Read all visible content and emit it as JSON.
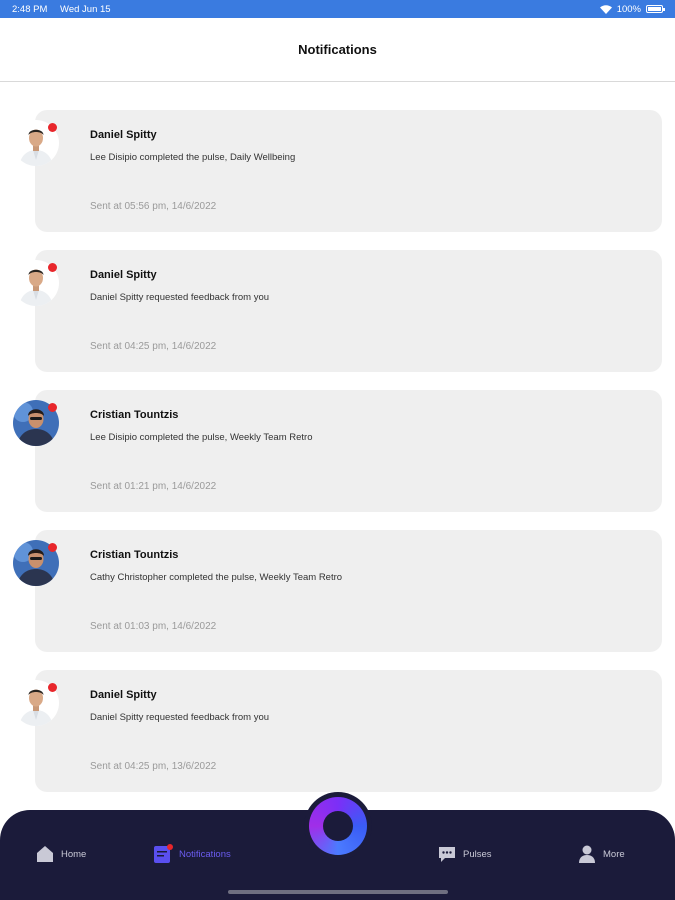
{
  "status_bar": {
    "time": "2:48 PM",
    "date": "Wed Jun 15",
    "battery": "100%"
  },
  "header": {
    "title": "Notifications"
  },
  "notifications": [
    {
      "sender": "Daniel Spitty",
      "message": "Lee Disipio completed the pulse, Daily Wellbeing",
      "time": "Sent at 05:56 pm, 14/6/2022",
      "avatar": "man-white-shirt",
      "unread": true
    },
    {
      "sender": "Daniel Spitty",
      "message": "Daniel Spitty requested feedback from you",
      "time": "Sent at 04:25 pm, 14/6/2022",
      "avatar": "man-white-shirt",
      "unread": true
    },
    {
      "sender": "Cristian Tountzis",
      "message": "Lee Disipio completed the pulse, Weekly Team Retro",
      "time": "Sent at 01:21 pm, 14/6/2022",
      "avatar": "man-blue-photo",
      "unread": true
    },
    {
      "sender": "Cristian Tountzis",
      "message": "Cathy Christopher completed the pulse, Weekly Team Retro",
      "time": "Sent at 01:03 pm, 14/6/2022",
      "avatar": "man-blue-photo",
      "unread": true
    },
    {
      "sender": "Daniel Spitty",
      "message": "Daniel Spitty requested feedback from you",
      "time": "Sent at 04:25 pm, 13/6/2022",
      "avatar": "man-white-shirt",
      "unread": true
    }
  ],
  "bottom_nav": {
    "home": "Home",
    "notifications": "Notifications",
    "pulses": "Pulses",
    "more": "More"
  },
  "colors": {
    "status_bar": "#3a7be0",
    "nav_background": "#1b1b3a",
    "active_nav": "#6b5cf0",
    "unread_dot": "#e8262b",
    "card": "#efefef"
  }
}
